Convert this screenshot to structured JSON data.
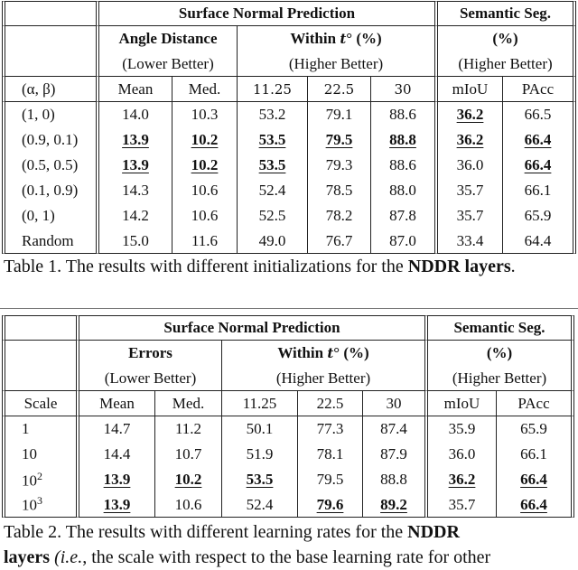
{
  "table1": {
    "header": {
      "group_surface": "Surface Normal Prediction",
      "group_semantic": "Semantic Seg.",
      "sub_angle": "Angle Distance",
      "sub_within": "Within t° (%)",
      "sub_within_prefix": "Within ",
      "sub_within_t": "t",
      "sub_within_suffix": "° (%)",
      "sub_semantic": "(%)",
      "lower_better": "(Lower Better)",
      "higher_better": "(Higher Better)",
      "higher_better_sem": "(Higher Better)",
      "row_label": "(α, β)",
      "columns": [
        "Mean",
        "Med.",
        "11.25",
        "22.5",
        "30",
        "mIoU",
        "PAcc"
      ]
    },
    "rows": [
      {
        "label": "(1, 0)",
        "values": [
          "14.0",
          "10.3",
          "53.2",
          "79.1",
          "88.6",
          "36.2",
          "66.5"
        ],
        "best": [
          false,
          false,
          false,
          false,
          false,
          true,
          false
        ]
      },
      {
        "label": "(0.9, 0.1)",
        "values": [
          "13.9",
          "10.2",
          "53.5",
          "79.5",
          "88.8",
          "36.2",
          "66.4"
        ],
        "best": [
          true,
          true,
          true,
          true,
          true,
          true,
          true
        ]
      },
      {
        "label": "(0.5, 0.5)",
        "values": [
          "13.9",
          "10.2",
          "53.5",
          "79.3",
          "88.6",
          "36.0",
          "66.4"
        ],
        "best": [
          true,
          true,
          true,
          false,
          false,
          false,
          true
        ]
      },
      {
        "label": "(0.1, 0.9)",
        "values": [
          "14.3",
          "10.6",
          "52.4",
          "78.5",
          "88.0",
          "35.7",
          "66.1"
        ],
        "best": [
          false,
          false,
          false,
          false,
          false,
          false,
          false
        ]
      },
      {
        "label": "(0, 1)",
        "values": [
          "14.2",
          "10.6",
          "52.5",
          "78.2",
          "87.8",
          "35.7",
          "65.9"
        ],
        "best": [
          false,
          false,
          false,
          false,
          false,
          false,
          false
        ]
      },
      {
        "label": "Random",
        "values": [
          "15.0",
          "11.6",
          "49.0",
          "76.7",
          "87.0",
          "33.4",
          "64.4"
        ],
        "best": [
          false,
          false,
          false,
          false,
          false,
          false,
          false
        ]
      }
    ],
    "caption_prefix": "Table 1. The results with different initializations for the ",
    "caption_bold": "NDDR layers",
    "caption_suffix": "."
  },
  "table2": {
    "header": {
      "group_surface": "Surface Normal Prediction",
      "group_semantic": "Semantic Seg.",
      "sub_errors": "Errors",
      "sub_within_prefix": "Within ",
      "sub_within_t": "t",
      "sub_within_suffix": "° (%)",
      "sub_semantic": "(%)",
      "lower_better": "(Lower Better)",
      "higher_better": "(Higher Better)",
      "higher_better_sem": "(Higher Better)",
      "row_label": "Scale",
      "columns": [
        "Mean",
        "Med.",
        "11.25",
        "22.5",
        "30",
        "mIoU",
        "PAcc"
      ]
    },
    "rows": [
      {
        "label": "1",
        "sup": "",
        "values": [
          "14.7",
          "11.2",
          "50.1",
          "77.3",
          "87.4",
          "35.9",
          "65.9"
        ],
        "best": [
          false,
          false,
          false,
          false,
          false,
          false,
          false
        ]
      },
      {
        "label": "10",
        "sup": "",
        "values": [
          "14.4",
          "10.7",
          "51.9",
          "78.1",
          "87.9",
          "36.0",
          "66.1"
        ],
        "best": [
          false,
          false,
          false,
          false,
          false,
          false,
          false
        ]
      },
      {
        "label": "10",
        "sup": "2",
        "values": [
          "13.9",
          "10.2",
          "53.5",
          "79.5",
          "88.8",
          "36.2",
          "66.4"
        ],
        "best": [
          true,
          true,
          true,
          false,
          false,
          true,
          true
        ]
      },
      {
        "label": "10",
        "sup": "3",
        "values": [
          "13.9",
          "10.6",
          "52.4",
          "79.6",
          "89.2",
          "35.7",
          "66.4"
        ],
        "best": [
          true,
          false,
          false,
          true,
          true,
          false,
          true
        ]
      }
    ],
    "caption_line1_prefix": "Table 2. The results with different learning rates for the ",
    "caption_line1_bold": "NDDR",
    "caption_line2_bold": "layers",
    "caption_line2_rest_italic": " (i.e.",
    "caption_line2_rest": ", the scale with respect to the base learning rate for other"
  }
}
